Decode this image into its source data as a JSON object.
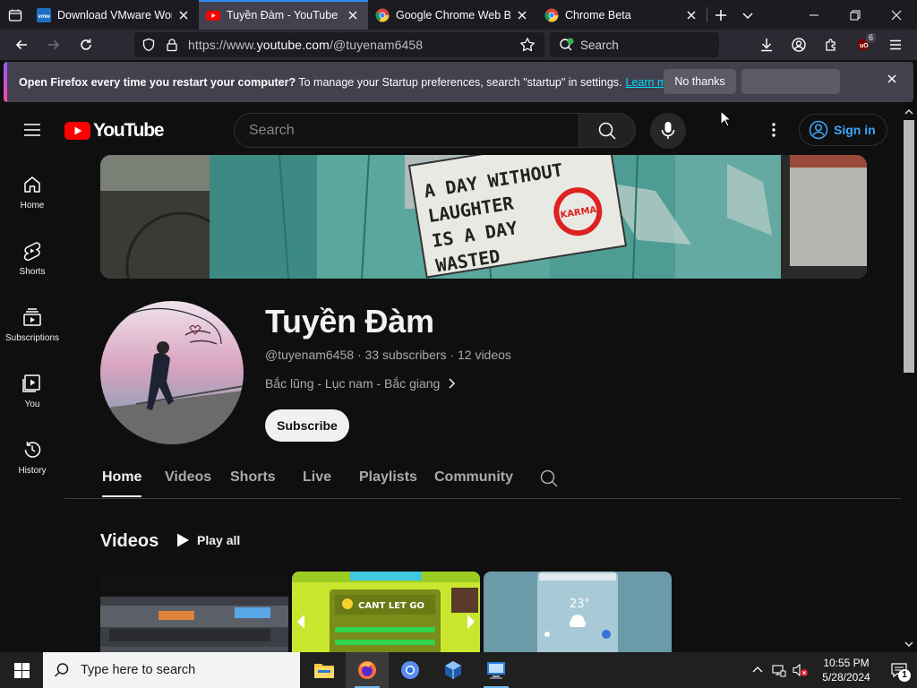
{
  "browser": {
    "tabs": [
      {
        "title": "Download VMware Work",
        "favicon": "vmware-icon",
        "active": false
      },
      {
        "title": "Tuyền Đàm - YouTube",
        "favicon": "youtube-icon",
        "active": true
      },
      {
        "title": "Google Chrome Web Bro",
        "favicon": "chrome-icon",
        "active": false
      },
      {
        "title": "Chrome Beta",
        "favicon": "chrome-icon",
        "active": false
      }
    ],
    "url_prefix": "https://www.",
    "url_domain": "youtube.com",
    "url_path": "/@tuyenam6458",
    "search_placeholder": "Search",
    "extensions_badge": "6"
  },
  "notification": {
    "bold": "Open Firefox every time you restart your computer?",
    "text": " To manage your Startup preferences, search \"startup\" in settings.",
    "link": "Learn more",
    "no_thanks": "No thanks"
  },
  "youtube": {
    "logo_text": "YouTube",
    "search_placeholder": "Search",
    "sign_in": "Sign in",
    "guide": [
      {
        "label": "Home",
        "icon": "home-icon"
      },
      {
        "label": "Shorts",
        "icon": "shorts-icon"
      },
      {
        "label": "Subscriptions",
        "icon": "subscriptions-icon"
      },
      {
        "label": "You",
        "icon": "you-icon"
      },
      {
        "label": "History",
        "icon": "history-icon"
      }
    ],
    "banner_text": [
      "A DAY WITHOUT",
      "LAUGHTER",
      "IS A DAY",
      "WASTED"
    ],
    "banner_karma": "KARMA",
    "channel": {
      "name": "Tuyền Đàm",
      "meta": "@tuyenam6458 · 33 subscribers · 12 videos",
      "description": "Bắc lũng - Lục nam - Bắc giang",
      "subscribe": "Subscribe"
    },
    "tabs": [
      "Home",
      "Videos",
      "Shorts",
      "Live",
      "Playlists",
      "Community"
    ],
    "section_title": "Videos",
    "play_all": "Play all",
    "thumb2_text": "CANT LET GO",
    "thumb3_text": "23°"
  },
  "taskbar": {
    "search_placeholder": "Type here to search",
    "time": "10:55 PM",
    "date": "5/28/2024",
    "notification_count": "1"
  }
}
